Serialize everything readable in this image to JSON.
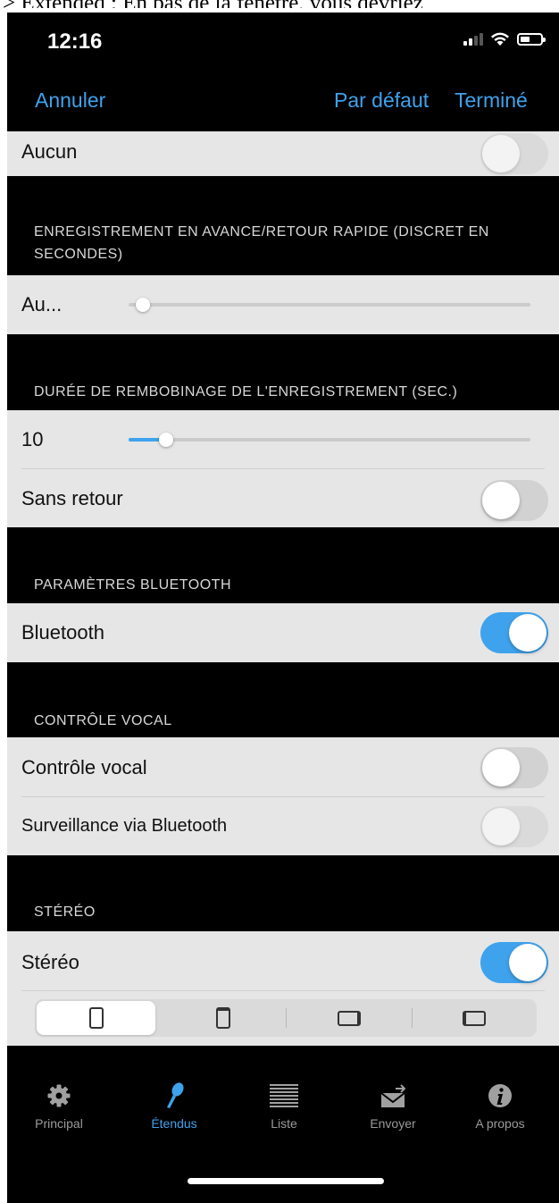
{
  "caption": "> Extended : En bas de la fenêtre, vous devriez",
  "status_bar": {
    "time": "12:16"
  },
  "nav": {
    "cancel": "Annuler",
    "default": "Par défaut",
    "done": "Terminé"
  },
  "rows": {
    "none": {
      "label": "Aucun",
      "toggle_on": false,
      "disabled": true
    },
    "ff_rw": {
      "label": "Au...",
      "slider_fraction": 0.0
    },
    "rewind": {
      "label": "10",
      "slider_fraction": 0.06
    },
    "no_return": {
      "label": "Sans retour",
      "toggle_on": false
    },
    "bluetooth": {
      "label": "Bluetooth",
      "toggle_on": true
    },
    "voice_control": {
      "label": "Contrôle vocal",
      "toggle_on": false
    },
    "bt_monitoring": {
      "label": "Surveillance via Bluetooth",
      "toggle_on": false,
      "disabled": true
    },
    "stereo": {
      "label": "Stéréo",
      "toggle_on": true
    }
  },
  "sections": {
    "ff_rw": "ENREGISTREMENT EN AVANCE/RETOUR RAPIDE (DISCRET EN SECONDES)",
    "rewind": "DURÉE DE REMBOBINAGE DE L'ENREGISTREMENT (SEC.)",
    "bluetooth": "PARAMÈTRES BLUETOOTH",
    "voice": "CONTRÔLE VOCAL",
    "stereo": "STÉRÉO"
  },
  "orientation_segments": {
    "selected_index": 0,
    "options": [
      "phone-portrait-icon",
      "phone-portrait-upside-icon",
      "phone-landscape-right-icon",
      "phone-landscape-left-icon"
    ]
  },
  "tabs": [
    {
      "label": "Principal",
      "icon": "gear-icon",
      "active": false
    },
    {
      "label": "Étendus",
      "icon": "microphone-icon",
      "active": true
    },
    {
      "label": "Liste",
      "icon": "list-icon",
      "active": false
    },
    {
      "label": "Envoyer",
      "icon": "send-mail-icon",
      "active": false
    },
    {
      "label": "A propos",
      "icon": "info-icon",
      "active": false
    }
  ],
  "colors": {
    "accent": "#3fa2ec",
    "background": "#000000",
    "row": "#e6e6e6",
    "tab_inactive": "#9a9a9a"
  }
}
